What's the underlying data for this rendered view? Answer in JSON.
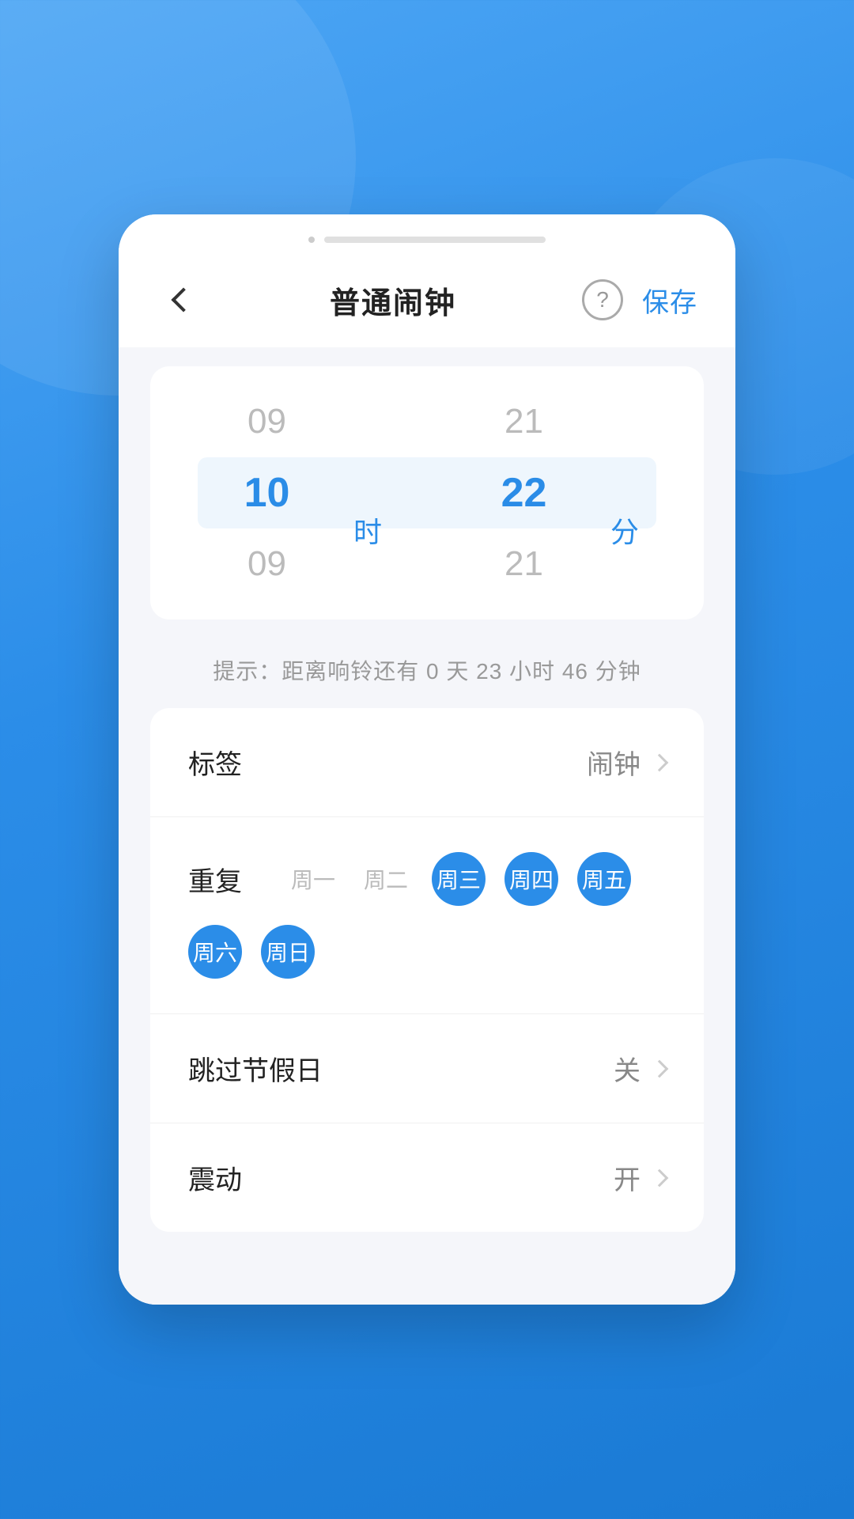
{
  "app": {
    "background_color_top": "#4da6f5",
    "background_color_bottom": "#1a7ad4"
  },
  "header": {
    "back_label": "<",
    "title": "普通闹钟",
    "help_icon": "?",
    "save_label": "保存"
  },
  "time_picker": {
    "hour_above": "09",
    "hour_active": "10",
    "hour_below": "09",
    "hour_unit": "时",
    "minute_above": "21",
    "minute_active": "22",
    "minute_below": "21",
    "minute_unit": "分"
  },
  "hint": {
    "text": "提示：距离响铃还有 0 天 23 小时 46 分钟"
  },
  "settings": {
    "label_label": "标签",
    "label_value": "闹钟",
    "repeat_label": "重复",
    "days": [
      {
        "label": "周一",
        "active": false
      },
      {
        "label": "周二",
        "active": false
      },
      {
        "label": "周三",
        "active": true
      },
      {
        "label": "周四",
        "active": true
      },
      {
        "label": "周五",
        "active": true
      },
      {
        "label": "周六",
        "active": true
      },
      {
        "label": "周日",
        "active": true
      }
    ],
    "holiday_label": "跳过节假日",
    "holiday_value": "关",
    "vibrate_label": "震动",
    "vibrate_value": "开"
  }
}
